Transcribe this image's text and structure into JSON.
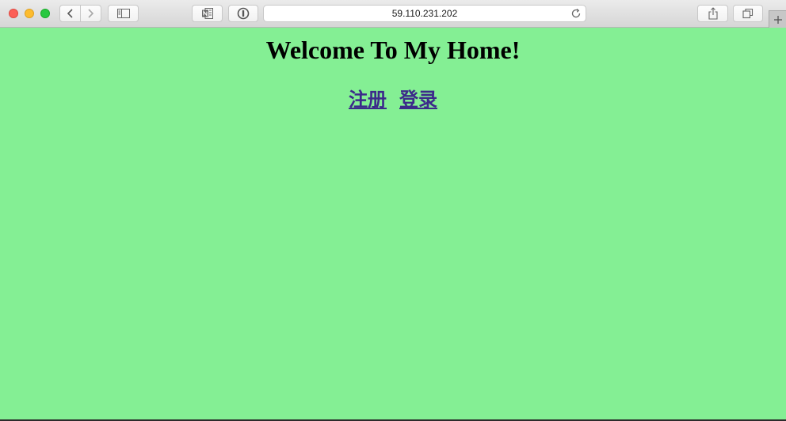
{
  "browser": {
    "url": "59.110.231.202",
    "icons": {
      "back": "chevron-left-icon",
      "forward": "chevron-right-icon",
      "sidebar": "sidebar-icon",
      "onenote": "onenote-icon",
      "password": "password-manager-icon",
      "reload": "reload-icon",
      "share": "share-icon",
      "tabs": "tabs-overview-icon",
      "new_tab": "plus-icon"
    }
  },
  "page": {
    "heading": "Welcome To My Home!",
    "links": {
      "register": "注册",
      "login": "登录"
    }
  },
  "colors": {
    "background": "#84ef94",
    "link": "#3c2a8a"
  }
}
